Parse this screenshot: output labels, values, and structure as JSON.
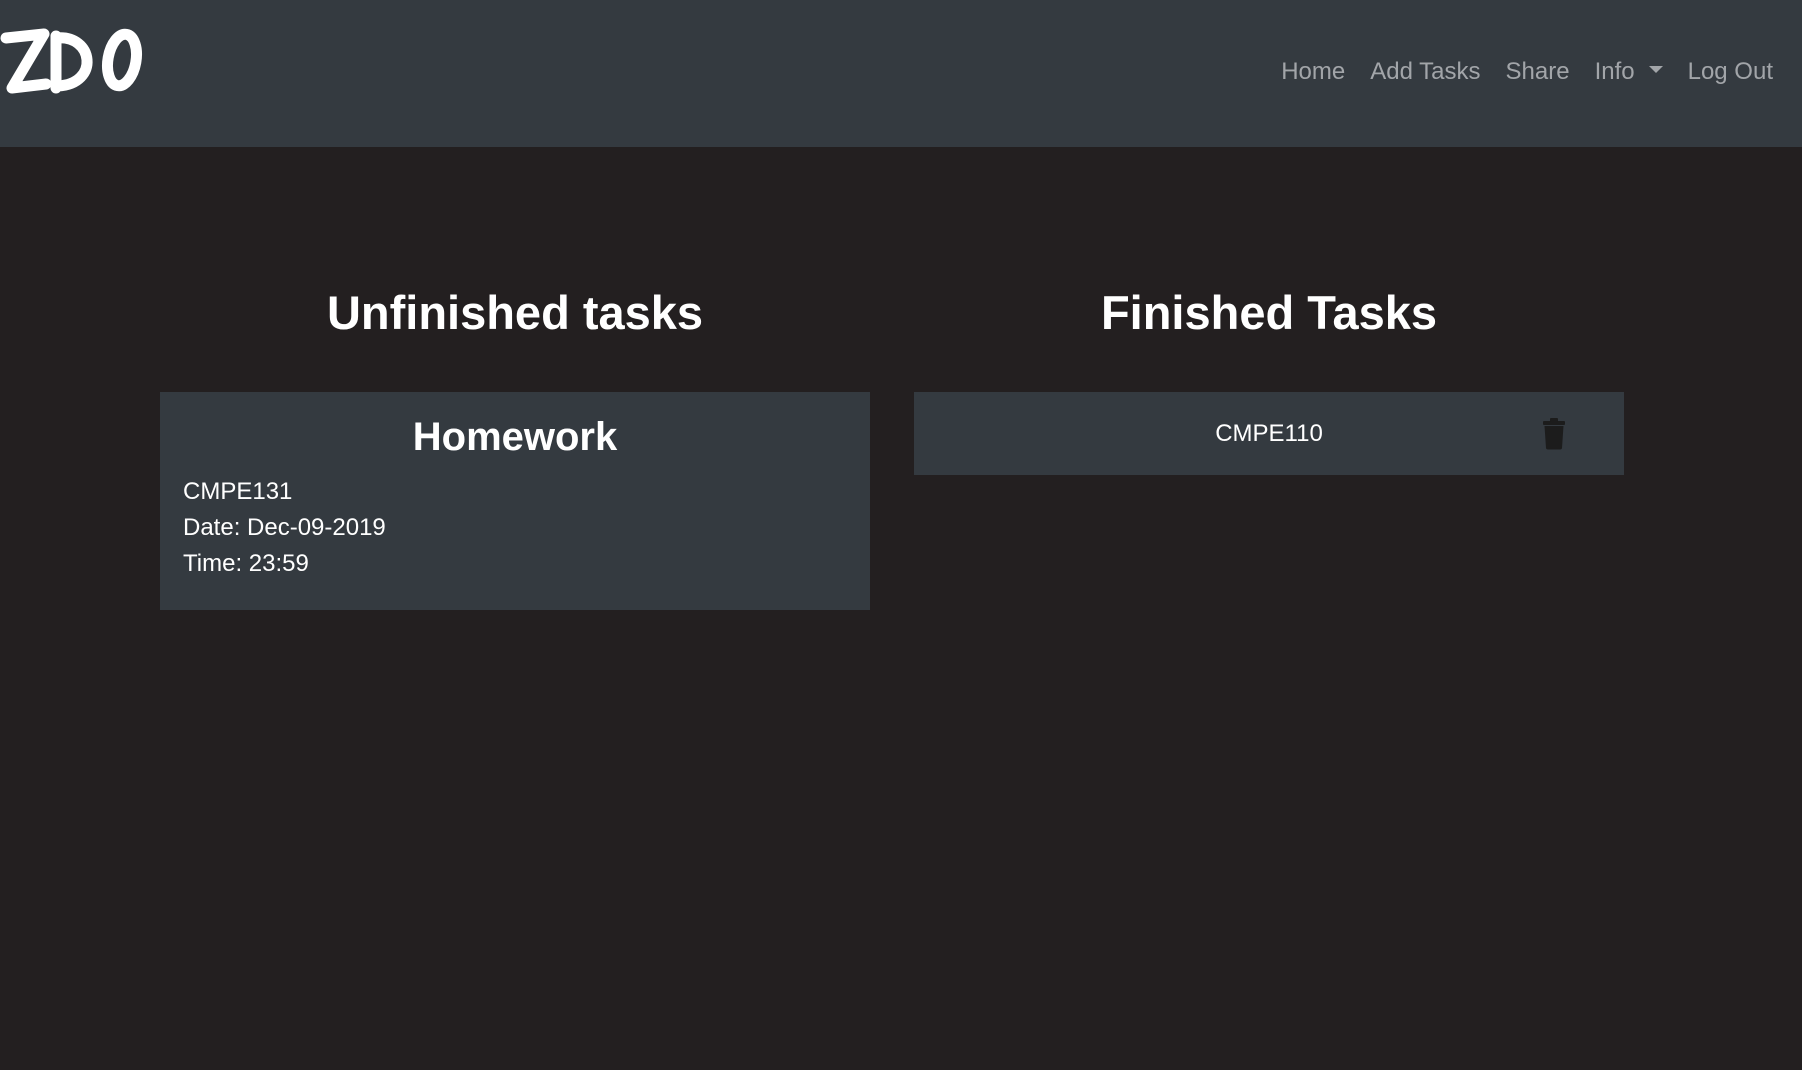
{
  "nav": {
    "logo_text": "ZDO",
    "links": [
      {
        "label": "Home"
      },
      {
        "label": "Add Tasks"
      },
      {
        "label": "Share"
      },
      {
        "label": "Info"
      },
      {
        "label": "Log Out"
      }
    ]
  },
  "unfinished": {
    "title": "Unfinished tasks",
    "tasks": [
      {
        "name": "Homework",
        "course": "CMPE131",
        "date": "Date: Dec-09-2019",
        "time": "Time: 23:59"
      }
    ]
  },
  "finished": {
    "title": "Finished Tasks",
    "items": [
      {
        "label": "CMPE110",
        "icon": "trash-icon"
      }
    ]
  },
  "colors": {
    "background": "#231f20",
    "navbar": "#343a40",
    "card": "#343a40",
    "nav_link": "#a2a5a9",
    "text": "#ffffff"
  }
}
